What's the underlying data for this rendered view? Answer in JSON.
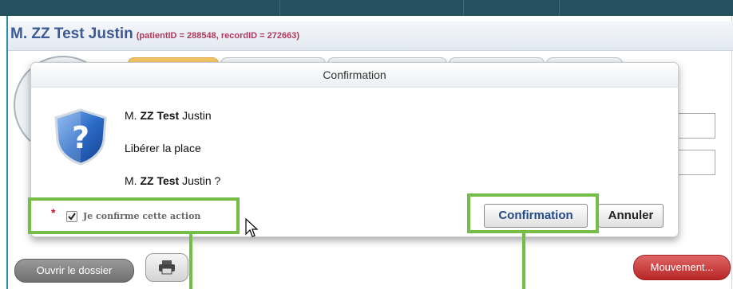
{
  "patient": {
    "name": "M. ZZ Test Justin",
    "ids": "(patientID = 288548, recordID = 272663)"
  },
  "dialog": {
    "title": "Confirmation",
    "line1": {
      "prefix": "M.",
      "bold": "ZZ Test",
      "suffix": "Justin"
    },
    "line2": "Libérer la place",
    "line3": {
      "prefix": "M.",
      "bold": "ZZ Test",
      "suffix": "Justin ?"
    },
    "required_mark": "*",
    "checkbox_label": "Je confirme cette action",
    "checkbox_checked": true,
    "confirm_label": "Confirmation",
    "cancel_label": "Annuler"
  },
  "footer": {
    "open_file_label": "Ouvrir le dossier",
    "movement_label": "Mouvement..."
  },
  "icons": {
    "dialog": "shield-question-icon",
    "print": "printer-icon",
    "check": "checkmark-icon",
    "pointer": "mouse-cursor-icon"
  },
  "colors": {
    "highlight": "#76bd47",
    "patient_name": "#3d5a95",
    "patient_ids": "#b0385a",
    "movement_button": "#c93636",
    "active_tab": "#f6c766"
  }
}
